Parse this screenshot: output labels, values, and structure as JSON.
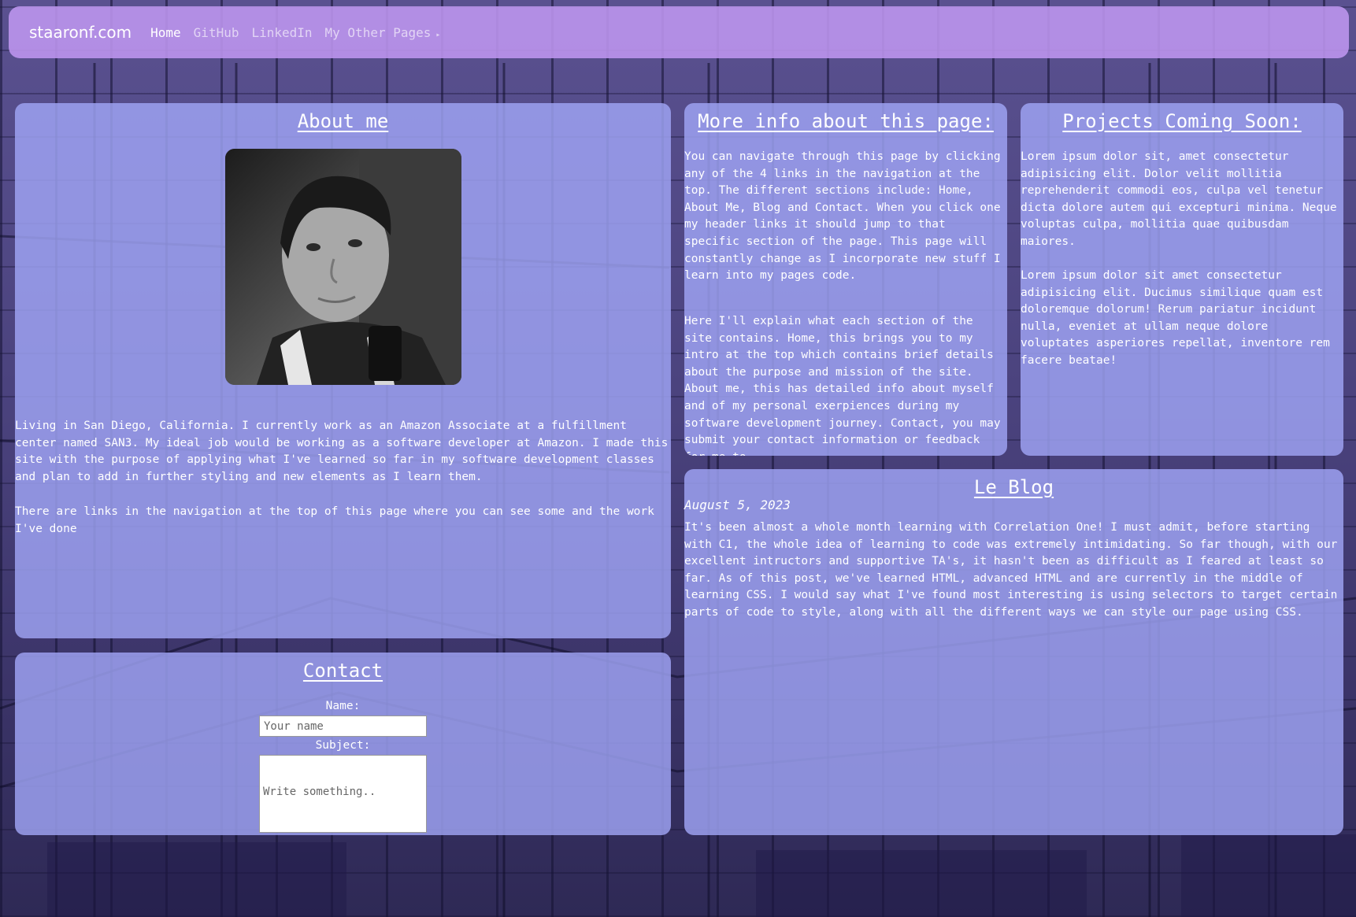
{
  "nav": {
    "brand": "staaronf.com",
    "links": [
      {
        "label": "Home"
      },
      {
        "label": "GitHub"
      },
      {
        "label": "LinkedIn"
      },
      {
        "label": "My Other Pages"
      }
    ]
  },
  "about": {
    "title": "About me",
    "p1": "Living in San Diego, California. I currently work as an Amazon Associate at a fulfillment center named SAN3. My ideal job would be working as a software developer at Amazon. I made this site with the purpose of applying what I've learned so far in my software development classes and plan to add in further styling and new elements as I learn them.",
    "p2": "There are links in the navigation at the top of this page where you can see some and the work I've done"
  },
  "more_info": {
    "title": "More info about this page:",
    "p1": "You can navigate through this page by clicking any of the 4 links in the navigation at the top. The different sections include: Home, About Me, Blog and Contact. When you click one my header links it should jump to that specific section of the page. This page will constantly change as I incorporate new stuff I learn into my pages code.",
    "p2": "Here I'll explain what each section of the site contains. Home, this brings you to my intro at the top which contains brief details about the purpose and mission of the site. About me, this has detailed info about myself and of my personal exerpiences during my software development journey. Contact, you may submit your contact information or feedback for me to"
  },
  "projects": {
    "title": "Projects Coming Soon:",
    "p1": "Lorem ipsum dolor sit, amet consectetur adipisicing elit. Dolor velit mollitia reprehenderit commodi eos, culpa vel tenetur dicta dolore autem qui excepturi minima. Neque voluptas culpa, mollitia quae quibusdam maiores.",
    "p2": "Lorem ipsum dolor sit amet consectetur adipisicing elit. Ducimus similique quam est doloremque dolorum! Rerum pariatur incidunt nulla, eveniet at ullam neque dolore voluptates asperiores repellat, inventore rem facere beatae!"
  },
  "blog": {
    "title": "Le Blog",
    "date": "August 5, 2023",
    "body": "It's been almost a whole month learning with Correlation One! I must admit, before starting with C1, the whole idea of learning to code was extremely intimidating. So far though, with our excellent intructors and supportive TA's, it hasn't been as difficult as I feared at least so far. As of this post, we've learned HTML, advanced HTML and are currently in the middle of learning CSS. I would say what I've found most interesting is using selectors to target certain parts of code to style, along with all the different ways we can style our page using CSS."
  },
  "contact": {
    "title": "Contact",
    "name_label": "Name:",
    "name_placeholder": "Your name",
    "subject_label": "Subject:",
    "subject_placeholder": "Write something.."
  },
  "colors": {
    "navbar": "#be96f0",
    "panel": "#a0a5f5",
    "text": "#ffffff"
  },
  "icons": {
    "dropdown": "caret-right-icon"
  }
}
